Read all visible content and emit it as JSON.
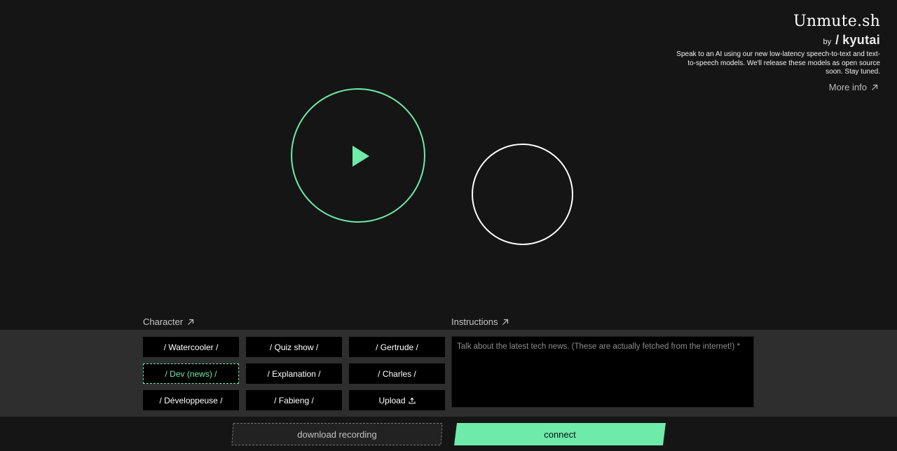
{
  "brand": {
    "title": "Unmute.sh",
    "by": "by",
    "slash": "/",
    "company": "kyutai",
    "description": "Speak to an AI using our new low-latency speech-to-text and text-to-speech models. We'll release these models as open source soon. Stay tuned.",
    "more_info": "More info"
  },
  "sections": {
    "character_label": "Character",
    "instructions_label": "Instructions"
  },
  "characters": [
    {
      "label": "/ Watercooler /"
    },
    {
      "label": "/ Quiz show /"
    },
    {
      "label": "/ Gertrude /"
    },
    {
      "label": "/ Dev (news) /"
    },
    {
      "label": "/ Explanation /"
    },
    {
      "label": "/ Charles /"
    },
    {
      "label": "/ Développeuse /"
    },
    {
      "label": "/ Fabieng /"
    },
    {
      "label": "Upload"
    }
  ],
  "selected_character": "/ Dev (news) /",
  "instructions": {
    "placeholder": "Talk about the latest tech news. (These are actually fetched from the internet!) *"
  },
  "actions": {
    "download": "download recording",
    "connect": "connect"
  },
  "colors": {
    "accent": "#6eeaa9",
    "background": "#151515",
    "panel": "#2e2e2e"
  },
  "icons": {
    "play": "play-icon",
    "external": "arrow-up-right-icon",
    "upload": "upload-icon"
  }
}
